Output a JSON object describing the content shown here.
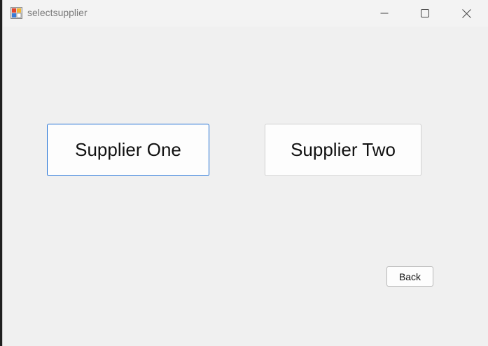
{
  "window": {
    "title": "selectsupplier",
    "app_icon": "form-app-icon",
    "controls": {
      "minimize_icon": "minimize-icon",
      "maximize_icon": "maximize-icon",
      "close_icon": "close-icon"
    }
  },
  "main": {
    "supplier_one_label": "Supplier One",
    "supplier_two_label": "Supplier Two",
    "back_label": "Back"
  },
  "colors": {
    "window_bg": "#f0f0f0",
    "focus_border": "#1f6fd4",
    "title_text": "#7a7a7a"
  }
}
